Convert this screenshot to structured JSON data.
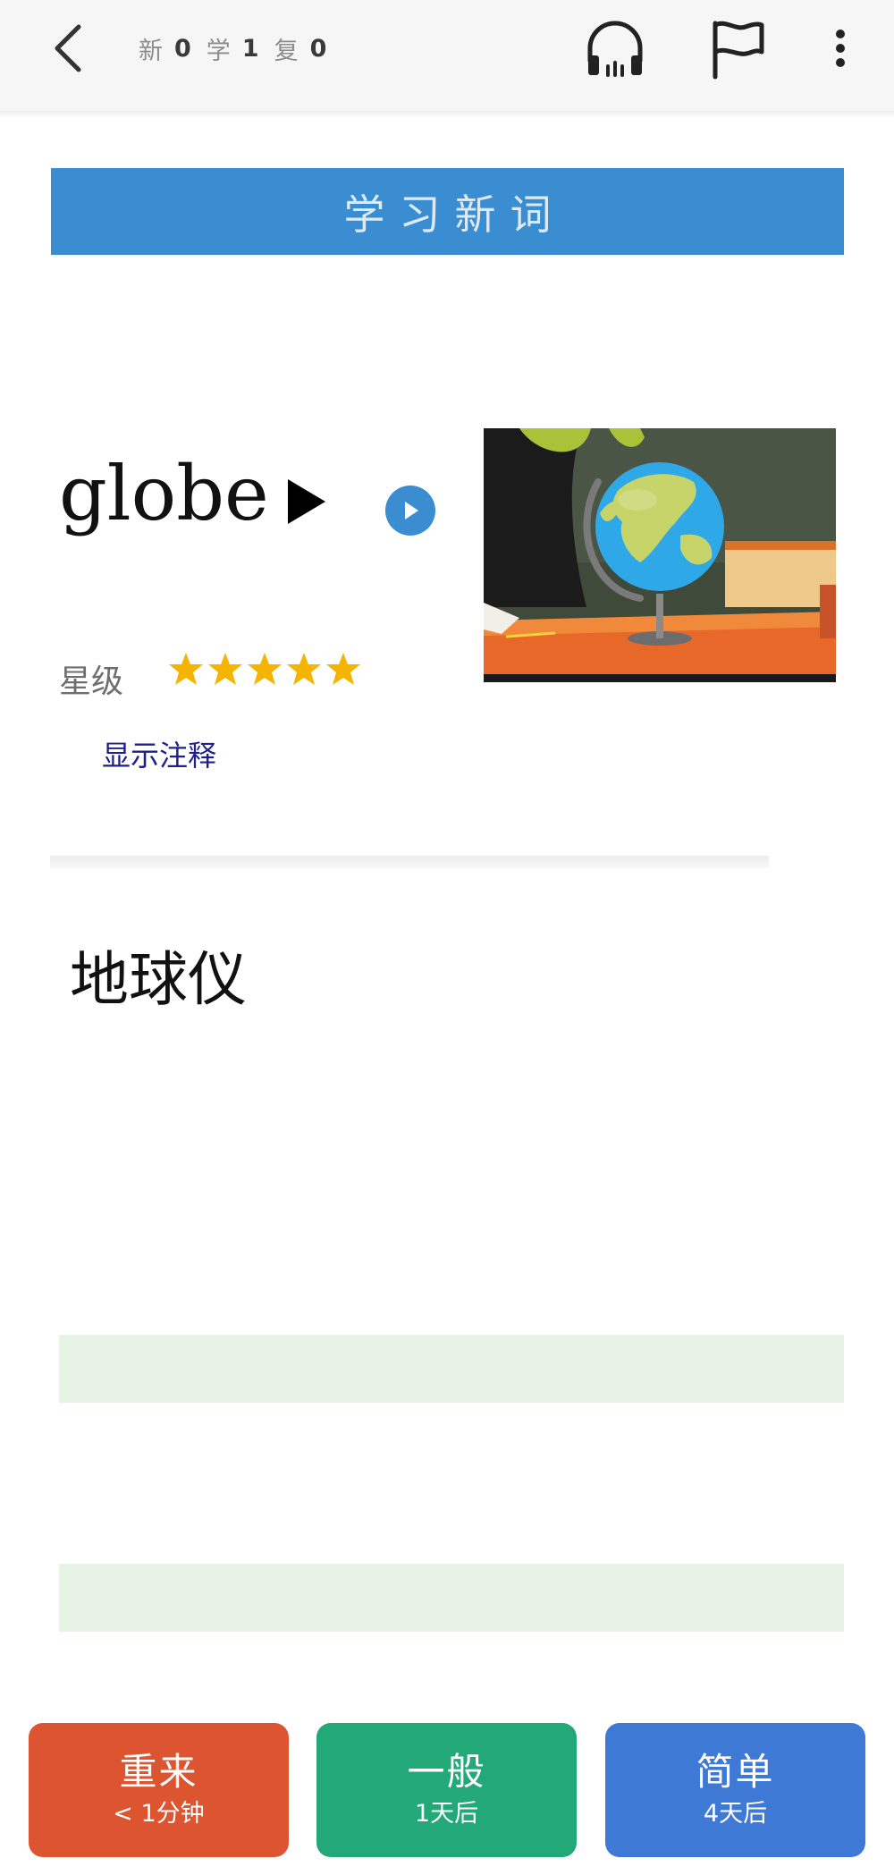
{
  "header": {
    "new_label": "新",
    "new_count": "0",
    "learn_label": "学",
    "learn_count": "1",
    "review_label": "复",
    "review_count": "0",
    "icons": [
      "back-arrow-icon",
      "headphone-icon",
      "flag-icon",
      "more-vertical-icon"
    ]
  },
  "banner": {
    "title": "学习新词"
  },
  "card": {
    "word": "globe",
    "star_label": "星级",
    "stars": 5,
    "show_notes": "显示注释",
    "meaning": "地球仪",
    "image": "globe-illustration"
  },
  "actions": [
    {
      "title": "重来",
      "subtitle": "< 1分钟",
      "color": "#dd5530"
    },
    {
      "title": "一般",
      "subtitle": "1天后",
      "color": "#23a878"
    },
    {
      "title": "简单",
      "subtitle": "4天后",
      "color": "#3f79d6"
    }
  ],
  "colors": {
    "banner": "#3a8dd0",
    "star": "#f5b400",
    "answer_band": "#e7f3e4",
    "link": "#1c1f8c"
  }
}
